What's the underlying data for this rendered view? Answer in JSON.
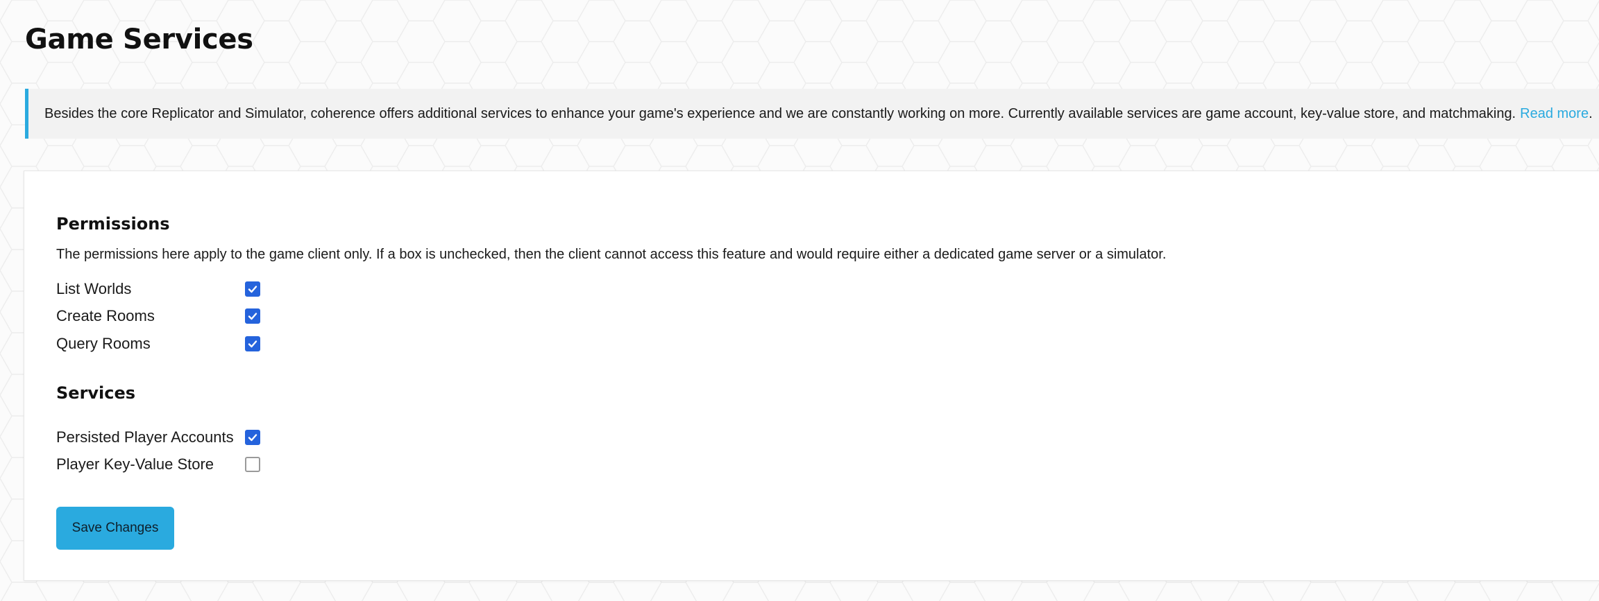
{
  "page": {
    "title": "Game Services"
  },
  "info_banner": {
    "text": "Besides the core Replicator and Simulator, coherence offers additional services to enhance your game's experience and we are constantly working on more. Currently available services are game account, key-value store, and matchmaking.",
    "link_label": "Read more",
    "trailing_text": "."
  },
  "permissions": {
    "heading": "Permissions",
    "description": "The permissions here apply to the game client only. If a box is unchecked, then the client cannot access this feature and would require either a dedicated game server or a simulator.",
    "items": [
      {
        "label": "List Worlds",
        "checked": true
      },
      {
        "label": "Create Rooms",
        "checked": true
      },
      {
        "label": "Query Rooms",
        "checked": true
      }
    ]
  },
  "services": {
    "heading": "Services",
    "items": [
      {
        "label": "Persisted Player Accounts",
        "checked": true
      },
      {
        "label": "Player Key-Value Store",
        "checked": false
      }
    ]
  },
  "actions": {
    "save_label": "Save Changes"
  },
  "colors": {
    "accent": "#2aaadf",
    "checkbox_checked": "#2563dc",
    "banner_background": "#f2f2f2",
    "card_background": "#ffffff"
  },
  "icons": {
    "checkmark": "check-icon",
    "background_pattern": "hexagon-pattern"
  }
}
